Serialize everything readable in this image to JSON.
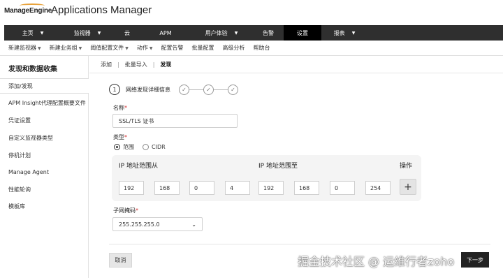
{
  "brand": {
    "name": "ManageEngine",
    "app_title": "Applications Manager"
  },
  "main_nav": [
    {
      "label": "主页",
      "caret": true
    },
    {
      "label": "监视器",
      "caret": true
    },
    {
      "label": "云",
      "caret": false
    },
    {
      "label": "APM",
      "caret": false
    },
    {
      "label": "用户体验",
      "caret": true
    },
    {
      "label": "告警",
      "caret": false
    },
    {
      "label": "设置",
      "caret": false,
      "active": true
    },
    {
      "label": "报表",
      "caret": true
    }
  ],
  "sub_nav": [
    {
      "label": "新建监视器",
      "caret": true
    },
    {
      "label": "新建业务组",
      "caret": true
    },
    {
      "label": "阈值配置文件",
      "caret": true
    },
    {
      "label": "动作",
      "caret": true
    },
    {
      "label": "配置告警",
      "caret": false
    },
    {
      "label": "批量配置",
      "caret": false
    },
    {
      "label": "高级分析",
      "caret": false
    },
    {
      "label": "帮助台",
      "caret": false
    }
  ],
  "sidebar": {
    "title": "发现和数据收集",
    "items": [
      {
        "label": "添加/发现",
        "active": true
      },
      {
        "label": "APM Insight代理配置概要文件"
      },
      {
        "label": "凭证设置"
      },
      {
        "label": "自定义监视器类型"
      },
      {
        "label": "停机计划"
      },
      {
        "label": "Manage Agent"
      },
      {
        "label": "性能轮询"
      },
      {
        "label": "模板库"
      }
    ]
  },
  "tabs": {
    "add": "添加",
    "bulk_import": "批量导入",
    "discover": "发现",
    "sep": "|"
  },
  "wizard": {
    "step_number": "1",
    "step_label": "网络发现详细信息"
  },
  "form": {
    "name_label": "名称",
    "name_value": "SSL/TLS 证书",
    "required_mark": "*",
    "type_label": "类型",
    "type_options": [
      "范围",
      "CIDR"
    ],
    "type_selected": "范围",
    "ip_from_label": "IP 地址范围从",
    "ip_to_label": "IP 地址范围至",
    "action_label": "操作",
    "ip_from": [
      "192",
      "168",
      "0",
      "4"
    ],
    "ip_to": [
      "192",
      "168",
      "0",
      "254"
    ],
    "add_symbol": "+",
    "subnet_label": "子网掩码",
    "subnet_value": "255.255.255.0"
  },
  "buttons": {
    "cancel": "取消",
    "next": "下一步"
  },
  "watermark": "掘金技术社区 @ 运维行者zoho"
}
